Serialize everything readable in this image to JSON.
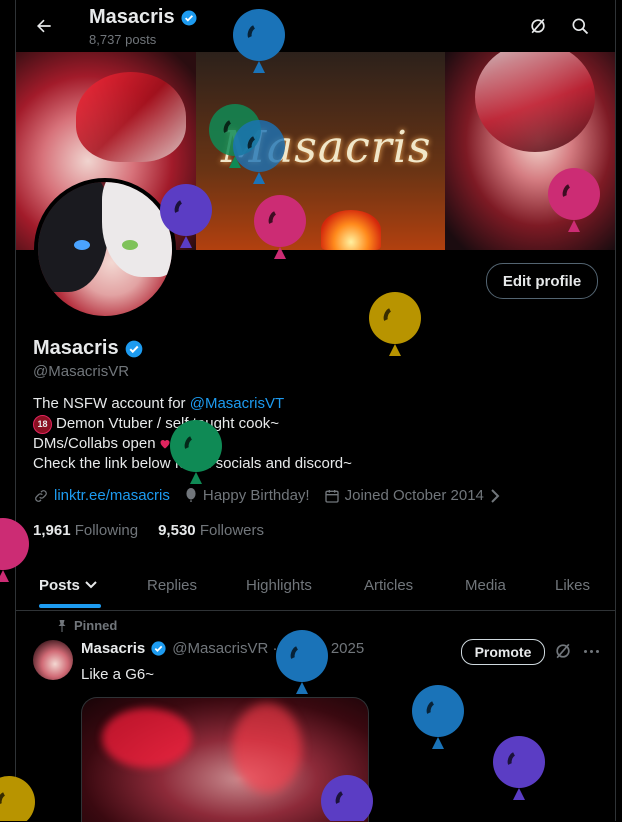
{
  "header": {
    "title": "Masacris",
    "posts_count": "8,737 posts"
  },
  "banner": {
    "logo_text": "Masacris"
  },
  "profile": {
    "edit_label": "Edit profile",
    "display_name": "Masacris",
    "handle": "@MasacrisVR",
    "bio": {
      "line1_prefix": "The NSFW account for ",
      "line1_mention": "@MasacrisVT",
      "line2_badge": "18",
      "line2_text": "Demon Vtuber / self taught cook~",
      "line3": "DMs/Collabs open",
      "line4": "Check the link below for all socials and discord~"
    },
    "meta": {
      "link": "linktr.ee/masacris",
      "birthday": "Happy Birthday!",
      "joined": "Joined October 2014"
    },
    "following_count": "1,961",
    "following_label": "Following",
    "followers_count": "9,530",
    "followers_label": "Followers"
  },
  "tabs": [
    {
      "label": "Posts"
    },
    {
      "label": "Replies"
    },
    {
      "label": "Highlights"
    },
    {
      "label": "Articles"
    },
    {
      "label": "Media"
    },
    {
      "label": "Likes"
    }
  ],
  "post": {
    "pinned_label": "Pinned",
    "author": "Masacris",
    "handle_date": "@MasacrisVR · 17 Jan 2025",
    "promote_label": "Promote",
    "text": "Like a G6~"
  },
  "colors": {
    "accent": "#1d9bf0",
    "balloon_blue": "#1a73b8",
    "balloon_green": "#0f8a55",
    "balloon_purple": "#5b3dc4",
    "balloon_pink": "#cc2c74",
    "balloon_gold": "#b89400"
  }
}
